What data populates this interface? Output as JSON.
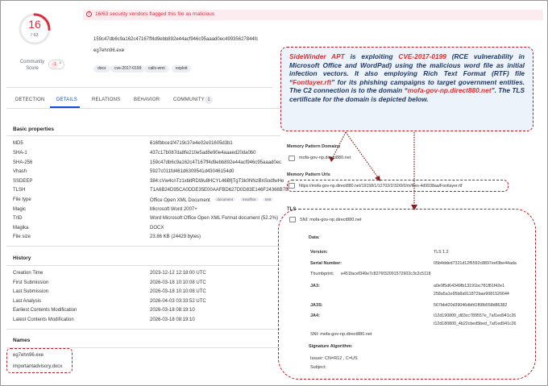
{
  "score": {
    "detections": "16",
    "total": "/ 63",
    "community_label": "Community Score",
    "community_value": "-1",
    "ring_color": "#e02c3c",
    "detection_ratio": 0.254
  },
  "banner": {
    "text": "16/63 security vendors flagged this file as malicious",
    "icon": "warning-circle-icon"
  },
  "file": {
    "hash": "159c47db6c9a162c47167ff4d9ebb892e44acf946c95aaad0ec49935627844fc",
    "name": "eg7ehn96.exe",
    "tags": [
      "docx",
      "cve-2017-0199",
      "calls-wmi",
      "exploit"
    ]
  },
  "tabs": [
    {
      "label": "DETECTION"
    },
    {
      "label": "DETAILS"
    },
    {
      "label": "RELATIONS"
    },
    {
      "label": "BEHAVIOR"
    },
    {
      "label": "COMMUNITY"
    }
  ],
  "community_count": "1",
  "basic": {
    "title": "Basic properties",
    "rows": [
      {
        "label": "MD5",
        "value": "616fbbce1f4719c37e4e02e01605d3b1"
      },
      {
        "label": "SHA-1",
        "value": "437c17b087da8fe210e5ad8e90e4aaaed20da0b0"
      },
      {
        "label": "SHA-256",
        "value": "159c47db6c9a162c47167ff4d9ebb892e44acf946c95aaad0ec"
      },
      {
        "label": "Vhash",
        "value": "5927c011fd461d6309541d43046154d0"
      },
      {
        "label": "SSDEEP",
        "value": "384:cVw4cnTz1xbitRDWu8HCYL46BfjTgT3k0NNzBnSodfwHe"
      },
      {
        "label": "TLSH",
        "value": "T1A6B24D95CA0DDE35E00AAFBD627D0D83E146F24366B7B"
      },
      {
        "label": "File type",
        "value": "Office Open XML Document",
        "chips": [
          "document",
          "msoffice",
          "text"
        ]
      },
      {
        "label": "Magic",
        "value": "Microsoft Word 2007+"
      },
      {
        "label": "TrID",
        "value": "Word Microsoft Office Open XML Format document (52.2%)"
      },
      {
        "label": "Magika",
        "value": "DOCX"
      },
      {
        "label": "File size",
        "value": "23.86 KB (24429 bytes)"
      }
    ]
  },
  "history": {
    "title": "History",
    "rows": [
      {
        "label": "Creation Time",
        "value": "2023-12-12 12:18:00 UTC"
      },
      {
        "label": "First Submission",
        "value": "2026-03-18 10:10:08 UTC"
      },
      {
        "label": "Last Submission",
        "value": "2026-03-18 10:10:08 UTC"
      },
      {
        "label": "Last Analysis",
        "value": "2026-04-03 03:33:52 UTC"
      },
      {
        "label": "Earliest Contents Modification",
        "value": "2026-03-18 08:19:10"
      },
      {
        "label": "Latest Contents Modification",
        "value": "2026-03-18 08:19:10"
      }
    ]
  },
  "names": {
    "title": "Names",
    "items": [
      "eg7ehn96.exe",
      "importantadvisory.docx"
    ]
  },
  "callout": {
    "p1_red": "SideWinder APT",
    "p2": " is exploiting ",
    "p3_red": "CVE-2017-0199",
    "p4": " (RCE vulnerability in Microsoft Office and WordPad) using the malicious word file as initial infection vectors. It also employing Rich Text Format (RTF) file “",
    "p5_red": "Fontlayer.rft",
    "p6": "” for its phishing campaigns to target government entities. The C2 connection is to the domain “",
    "p7_red": "mofa-gov-np.direct880.net",
    "p8": "”. The TLS certificate for the domain is depicted below."
  },
  "memory": {
    "domains_title": "Memory Pattern Domains",
    "domain": "mofa-gov-np.direct880.net",
    "urls_title": "Memory Pattern Urls",
    "url": "https://mofa-gov-np.direct880.net/19158/1/12702/2/32/0/0/m/files-4d9938aa/Fontlayer.rtf"
  },
  "tls": {
    "title": "TLS",
    "sni": "SNI: mofa-gov-np.direct880.net",
    "data_label": "Data:",
    "version_label": "Version:",
    "version": "TLS 1.2",
    "serial_label": "Serial Number:",
    "serial": "05b4dded7321d12f6592c8897eef3be44ada",
    "thumb_label": "Thumbprint:",
    "thumb": "e451facef349e7c8276f3209157260​2c3c2c5118",
    "ja3_label": "JA3:",
    "ja3_1": "a0e9f5d64349fb13191bc781f81f42e1",
    "ja3_2": "258a5a1e95b8a911872bae9081526644",
    "ja3s_label": "JA3S:",
    "ja3s": "567bb420d39046dbfd1f68b558d86382",
    "ja4_label": "JA4:",
    "ja4_1": "t12d190800_d83cc789557e_7af1ed941c26",
    "ja4_2": "t12d180800_4b22cbed5bed_7af1ed941c26",
    "sni2": "SNI: mofa-gov-np.direct880.net",
    "sig_label": "Signature Algorithm:",
    "issuer": "Issuer: CN=R12 , C=US",
    "subject": "Subject:"
  }
}
